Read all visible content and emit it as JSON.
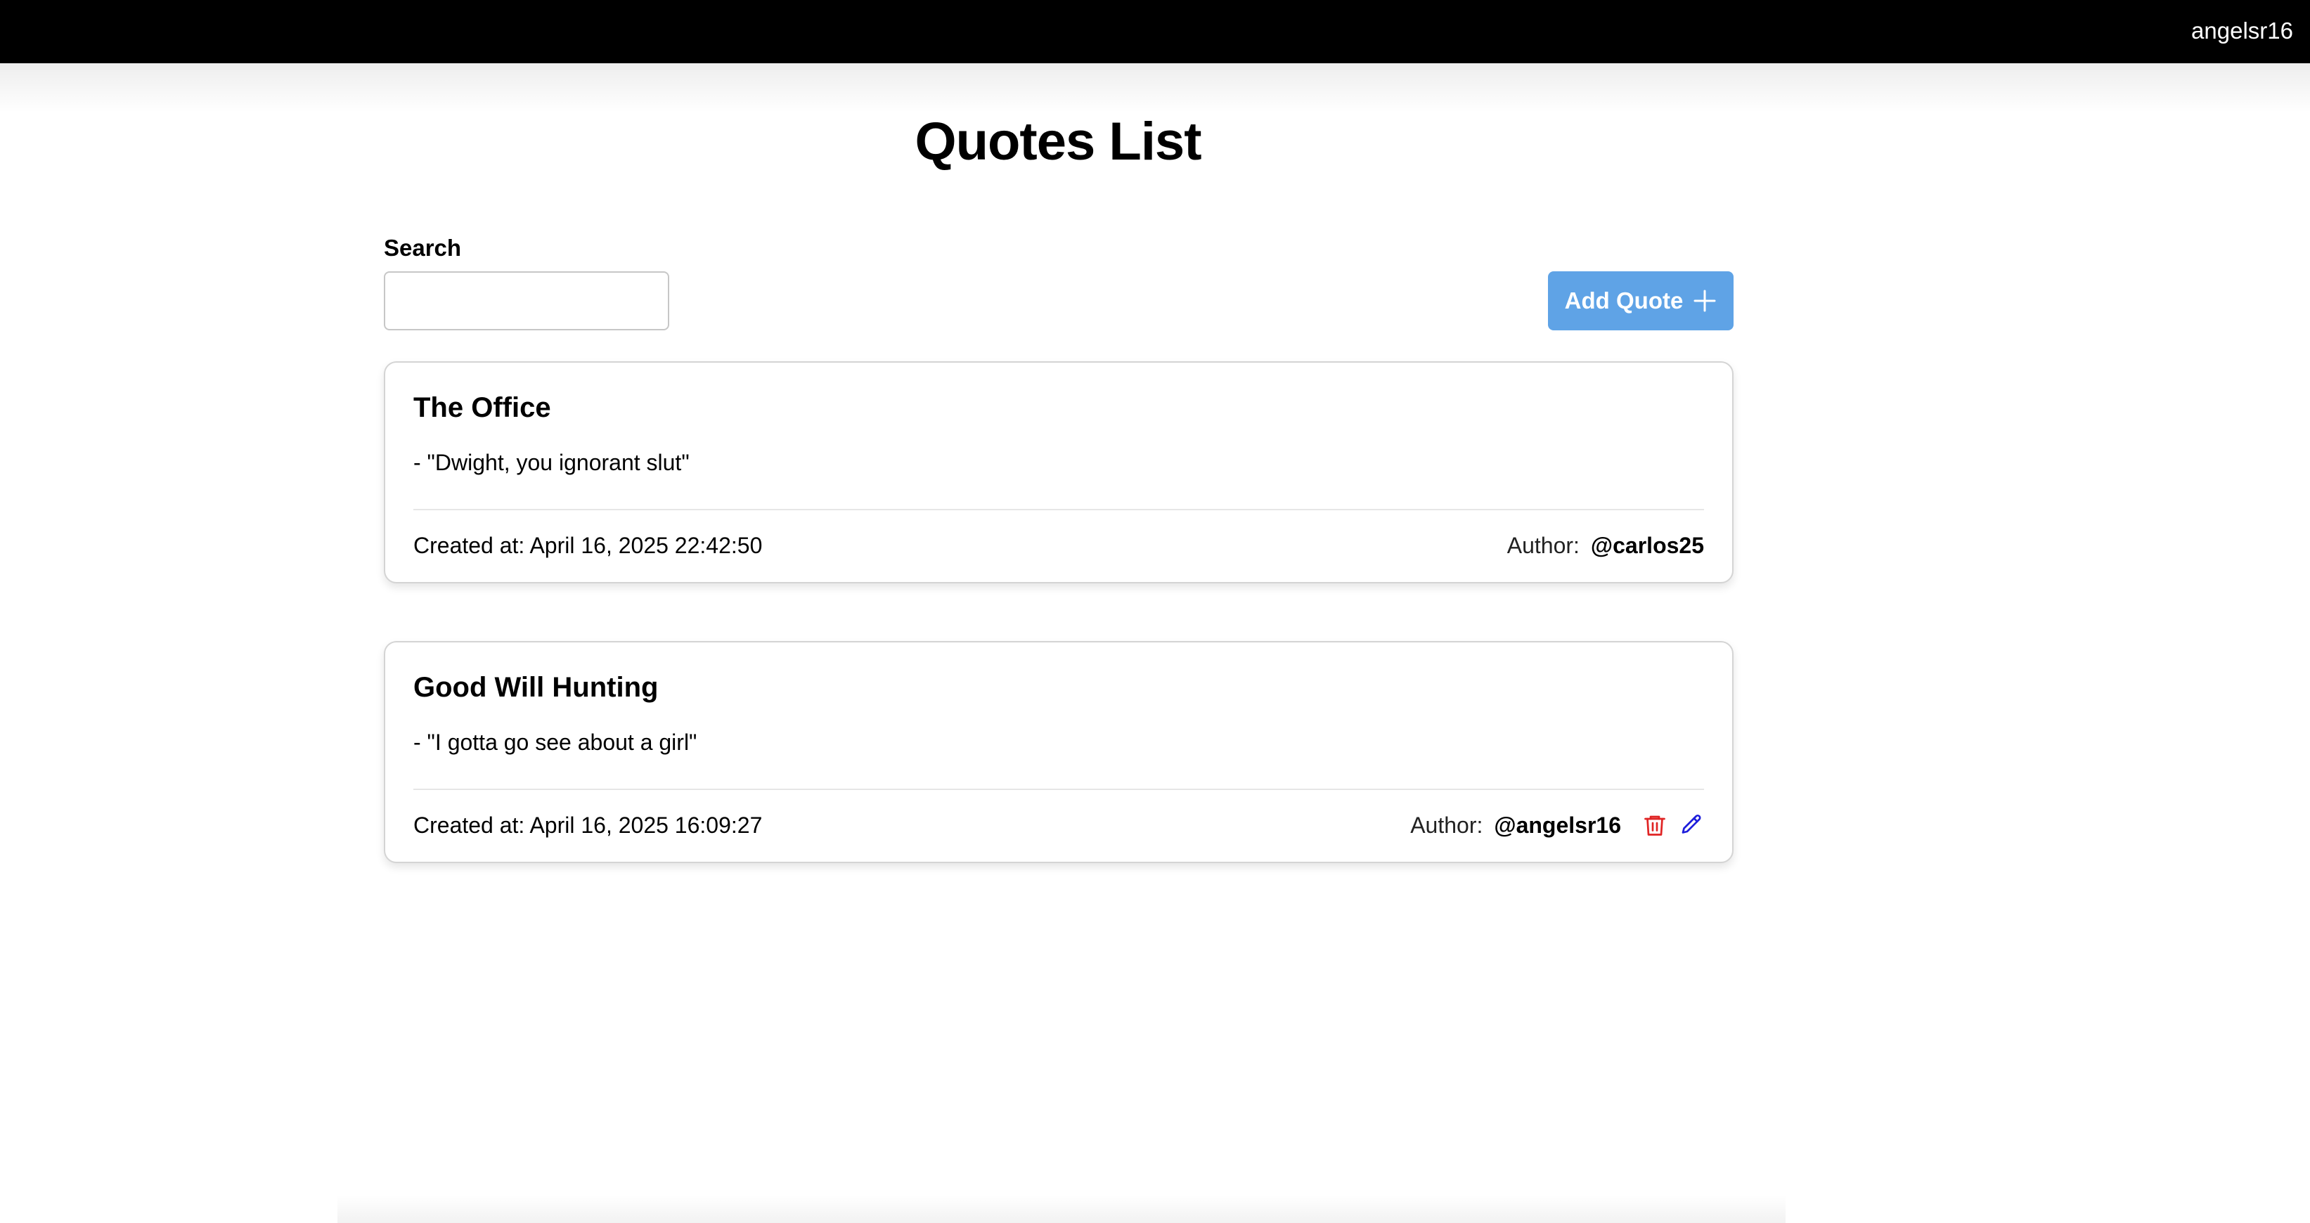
{
  "topbar": {
    "username": "angelsr16"
  },
  "page": {
    "title": "Quotes List"
  },
  "search": {
    "label": "Search",
    "value": "",
    "placeholder": ""
  },
  "toolbar": {
    "add_label": "Add Quote",
    "add_icon": "plus-icon"
  },
  "quotes": [
    {
      "title": "The Office",
      "quote": "- \"Dwight, you ignorant slut\"",
      "created_at": "Created at: April 16, 2025 22:42:50",
      "author_label": "Author:",
      "author": "@carlos25",
      "can_edit": false
    },
    {
      "title": "Good Will Hunting",
      "quote": "- \"I gotta go see about a girl\"",
      "created_at": "Created at: April 16, 2025 16:09:27",
      "author_label": "Author:",
      "author": "@angelsr16",
      "can_edit": true,
      "actions": [
        "trash-icon",
        "pencil-icon"
      ]
    }
  ],
  "colors": {
    "topbar_bg": "#000000",
    "accent_button": "#5fa3e6",
    "delete_icon": "#e02424",
    "edit_icon": "#1d1ddb"
  }
}
